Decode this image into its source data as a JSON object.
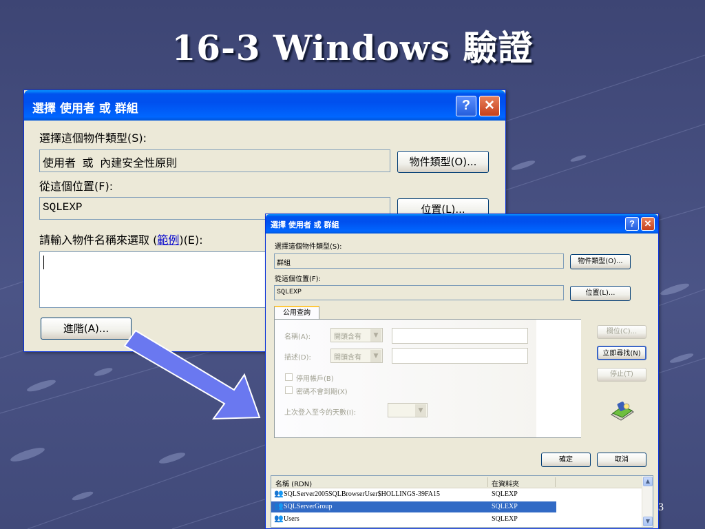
{
  "slide": {
    "title": "16-3 Windows 驗證",
    "page_number": "3"
  },
  "back_dialog": {
    "title": "選擇 使用者 或 群組",
    "help_label": "?",
    "close_label": "✕",
    "object_type_label": "選擇這個物件類型(S):",
    "object_type_value": "使用者 或 內建安全性原則",
    "object_types_button": "物件類型(O)...",
    "location_label": "從這個位置(F):",
    "location_value": "SQLEXP",
    "locations_button": "位置(L)...",
    "enter_label_prefix": "請輸入物件名稱來選取 (",
    "examples_link": "範例",
    "enter_label_suffix": ")(E):",
    "name_input_value": "",
    "advanced_button": "進階(A)..."
  },
  "front_dialog": {
    "title": "選擇 使用者 或 群組",
    "help_label": "?",
    "close_label": "✕",
    "object_type_label": "選擇這個物件類型(S):",
    "object_type_value": "群組",
    "object_types_button": "物件類型(O)...",
    "location_label": "從這個位置(F):",
    "location_value": "SQLEXP",
    "locations_button": "位置(L)...",
    "tab_label": "公用查詢",
    "name_label": "名稱(A):",
    "name_mode": "開頭含有",
    "desc_label": "描述(D):",
    "desc_mode": "開頭含有",
    "disabled_accounts": "停用帳戶(B)",
    "non_expiring": "密碼不會到期(X)",
    "days_since_login": "上次登入至今的天數(I):",
    "columns_button": "欄位(C)...",
    "find_now_button": "立即尋找(N)",
    "stop_button": "停止(T)",
    "ok_button": "確定",
    "cancel_button": "取消",
    "results": {
      "columns": [
        "名稱 (RDN)",
        "在資料夾"
      ],
      "rows": [
        {
          "name": "SQLServer2005SQLBrowserUser$HOLLINGS-39FA15",
          "folder": "SQLEXP",
          "selected": false
        },
        {
          "name": "SQLServerGroup",
          "folder": "SQLEXP",
          "selected": true
        },
        {
          "name": "Users",
          "folder": "SQLEXP",
          "selected": false
        }
      ]
    }
  },
  "colors": {
    "slide_bg": "#454e80",
    "titlebar": "#0054e3",
    "dialog_bg": "#ece9d8",
    "selection": "#316ac5",
    "arrow": "#6677ee"
  }
}
